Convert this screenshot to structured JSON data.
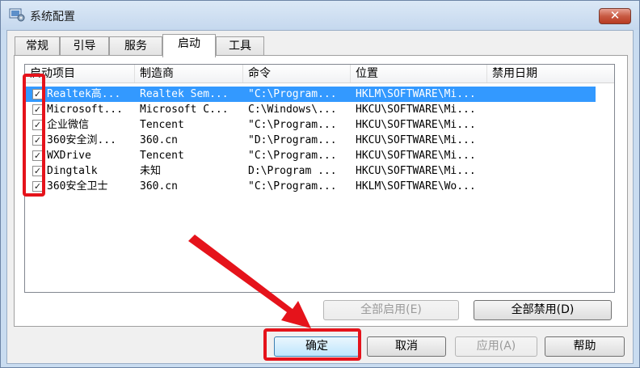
{
  "window": {
    "title": "系统配置",
    "close_label": "✕"
  },
  "tabs": [
    {
      "label": "常规"
    },
    {
      "label": "引导"
    },
    {
      "label": "服务"
    },
    {
      "label": "启动"
    },
    {
      "label": "工具"
    }
  ],
  "table": {
    "columns": [
      "启动项目",
      "制造商",
      "命令",
      "位置",
      "禁用日期"
    ],
    "rows": [
      {
        "checked": true,
        "item": "Realtek高...",
        "maker": "Realtek Sem...",
        "command": "\"C:\\Program...",
        "location": "HKLM\\SOFTWARE\\Mi...",
        "disabled_date": ""
      },
      {
        "checked": true,
        "item": "Microsoft...",
        "maker": "Microsoft C...",
        "command": "C:\\Windows\\...",
        "location": "HKCU\\SOFTWARE\\Mi...",
        "disabled_date": ""
      },
      {
        "checked": true,
        "item": "企业微信",
        "maker": "Tencent",
        "command": "\"C:\\Program...",
        "location": "HKCU\\SOFTWARE\\Mi...",
        "disabled_date": ""
      },
      {
        "checked": true,
        "item": "360安全浏...",
        "maker": "360.cn",
        "command": "\"D:\\Program...",
        "location": "HKCU\\SOFTWARE\\Mi...",
        "disabled_date": ""
      },
      {
        "checked": true,
        "item": "WXDrive",
        "maker": "Tencent",
        "command": "\"C:\\Program...",
        "location": "HKCU\\SOFTWARE\\Mi...",
        "disabled_date": ""
      },
      {
        "checked": true,
        "item": "Dingtalk",
        "maker": "未知",
        "command": "D:\\Program ...",
        "location": "HKCU\\SOFTWARE\\Mi...",
        "disabled_date": ""
      },
      {
        "checked": true,
        "item": "360安全卫士",
        "maker": "360.cn",
        "command": "\"C:\\Program...",
        "location": "HKLM\\SOFTWARE\\Wo...",
        "disabled_date": ""
      }
    ]
  },
  "buttons": {
    "enable_all": "全部启用(E)",
    "disable_all": "全部禁用(D)",
    "ok": "确定",
    "cancel": "取消",
    "apply": "应用(A)",
    "help": "帮助"
  },
  "annotation_color": "#e5131b"
}
